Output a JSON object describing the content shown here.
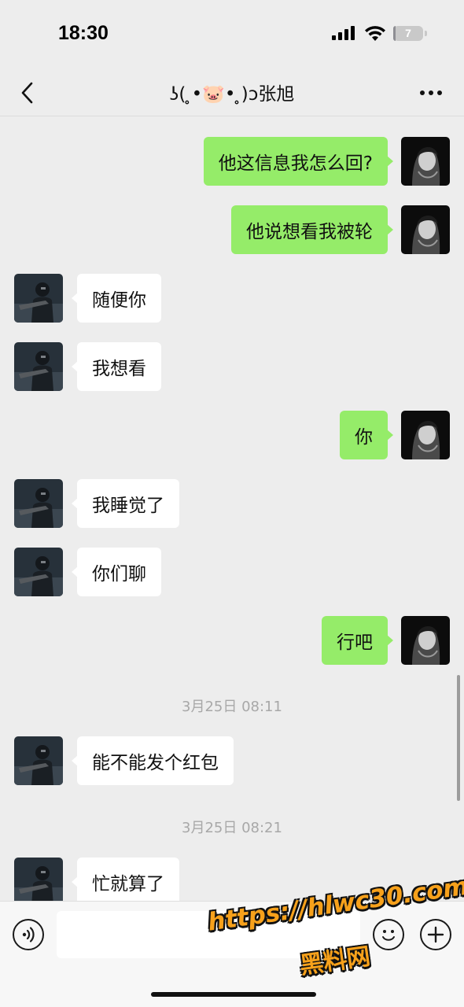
{
  "status_bar": {
    "time": "18:30",
    "battery_level": "7",
    "battery_fraction": 0.07
  },
  "nav": {
    "title": "ʖ( ̥•🐷• ̥)ɔ张旭",
    "back_icon": "chevron-left-icon",
    "more_icon": "more-dots-icon"
  },
  "messages": [
    {
      "sender": "me",
      "text": "他这信息我怎么回?"
    },
    {
      "sender": "me",
      "text": "他说想看我被轮"
    },
    {
      "sender": "other",
      "text": "随便你"
    },
    {
      "sender": "other",
      "text": "我想看"
    },
    {
      "sender": "me",
      "text": "你"
    },
    {
      "sender": "other",
      "text": "我睡觉了"
    },
    {
      "sender": "other",
      "text": "你们聊"
    },
    {
      "sender": "me",
      "text": "行吧"
    },
    {
      "sender": "timestamp",
      "text": "3月25日 08:11"
    },
    {
      "sender": "other",
      "text": "能不能发个红包"
    },
    {
      "sender": "timestamp",
      "text": "3月25日 08:21"
    },
    {
      "sender": "other",
      "text": "忙就算了"
    }
  ],
  "input_bar": {
    "voice_icon": "voice-icon",
    "emoji_icon": "emoji-icon",
    "plus_icon": "plus-icon",
    "input_value": ""
  },
  "watermark": {
    "url": "https://hlwc30.com",
    "name": "黑料网"
  },
  "colors": {
    "background": "#ededed",
    "my_bubble": "#95ec69",
    "other_bubble": "#ffffff",
    "timestamp": "#a8a8a8",
    "watermark": "#f7a11b"
  }
}
